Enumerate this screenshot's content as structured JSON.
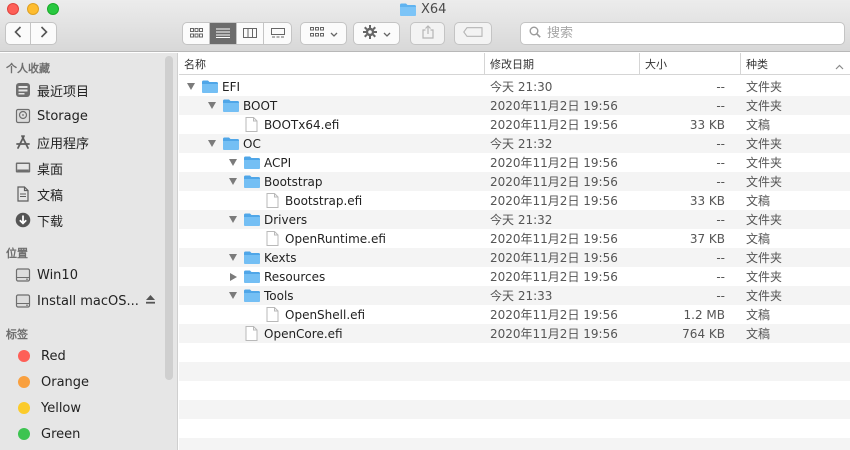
{
  "window": {
    "title": "X64"
  },
  "toolbar": {
    "search_placeholder": "搜索",
    "icons": [
      "chevron-left-icon",
      "chevron-right-icon",
      "icon-view-icon",
      "list-view-icon",
      "column-view-icon",
      "gallery-view-icon",
      "group-icon",
      "gear-icon",
      "share-icon",
      "tag-icon",
      "search-icon"
    ]
  },
  "sidebar": {
    "favorites_header": "个人收藏",
    "favorites": [
      {
        "label": "最近项目",
        "icon": "recents-icon"
      },
      {
        "label": "Storage",
        "icon": "drive-icon"
      },
      {
        "label": "应用程序",
        "icon": "applications-icon"
      },
      {
        "label": "桌面",
        "icon": "desktop-icon"
      },
      {
        "label": "文稿",
        "icon": "documents-icon"
      },
      {
        "label": "下载",
        "icon": "downloads-icon"
      }
    ],
    "locations_header": "位置",
    "locations": [
      {
        "label": "Win10",
        "icon": "drive-icon"
      },
      {
        "label": "Install macOS...",
        "icon": "drive-icon"
      }
    ],
    "tags_header": "标签",
    "tags": [
      {
        "label": "Red",
        "color": "#fe5f57"
      },
      {
        "label": "Orange",
        "color": "#f9a03f"
      },
      {
        "label": "Yellow",
        "color": "#fbcb2b"
      },
      {
        "label": "Green",
        "color": "#3dc451"
      }
    ]
  },
  "columns": {
    "name": "名称",
    "date": "修改日期",
    "size": "大小",
    "kind": "种类"
  },
  "rows": [
    {
      "name": "EFI",
      "type": "folder",
      "level": 0,
      "disclosure": "open",
      "date": "今天 21:30",
      "size": "--",
      "kind": "文件夹"
    },
    {
      "name": "BOOT",
      "type": "folder",
      "level": 1,
      "disclosure": "open",
      "date": "2020年11月2日 19:56",
      "size": "--",
      "kind": "文件夹"
    },
    {
      "name": "BOOTx64.efi",
      "type": "file",
      "level": 2,
      "disclosure": "none",
      "date": "2020年11月2日 19:56",
      "size": "33 KB",
      "kind": "文稿"
    },
    {
      "name": "OC",
      "type": "folder",
      "level": 1,
      "disclosure": "open",
      "date": "今天 21:32",
      "size": "--",
      "kind": "文件夹"
    },
    {
      "name": "ACPI",
      "type": "folder",
      "level": 2,
      "disclosure": "open",
      "date": "2020年11月2日 19:56",
      "size": "--",
      "kind": "文件夹"
    },
    {
      "name": "Bootstrap",
      "type": "folder",
      "level": 2,
      "disclosure": "open",
      "date": "2020年11月2日 19:56",
      "size": "--",
      "kind": "文件夹"
    },
    {
      "name": "Bootstrap.efi",
      "type": "file",
      "level": 3,
      "disclosure": "none",
      "date": "2020年11月2日 19:56",
      "size": "33 KB",
      "kind": "文稿"
    },
    {
      "name": "Drivers",
      "type": "folder",
      "level": 2,
      "disclosure": "open",
      "date": "今天 21:32",
      "size": "--",
      "kind": "文件夹"
    },
    {
      "name": "OpenRuntime.efi",
      "type": "file",
      "level": 3,
      "disclosure": "none",
      "date": "2020年11月2日 19:56",
      "size": "37 KB",
      "kind": "文稿"
    },
    {
      "name": "Kexts",
      "type": "folder",
      "level": 2,
      "disclosure": "open",
      "date": "2020年11月2日 19:56",
      "size": "--",
      "kind": "文件夹"
    },
    {
      "name": "Resources",
      "type": "folder",
      "level": 2,
      "disclosure": "closed",
      "date": "2020年11月2日 19:56",
      "size": "--",
      "kind": "文件夹"
    },
    {
      "name": "Tools",
      "type": "folder",
      "level": 2,
      "disclosure": "open",
      "date": "今天 21:33",
      "size": "--",
      "kind": "文件夹"
    },
    {
      "name": "OpenShell.efi",
      "type": "file",
      "level": 3,
      "disclosure": "none",
      "date": "2020年11月2日 19:56",
      "size": "1.2 MB",
      "kind": "文稿"
    },
    {
      "name": "OpenCore.efi",
      "type": "file",
      "level": 2,
      "disclosure": "none",
      "date": "2020年11月2日 19:56",
      "size": "764 KB",
      "kind": "文稿"
    }
  ]
}
